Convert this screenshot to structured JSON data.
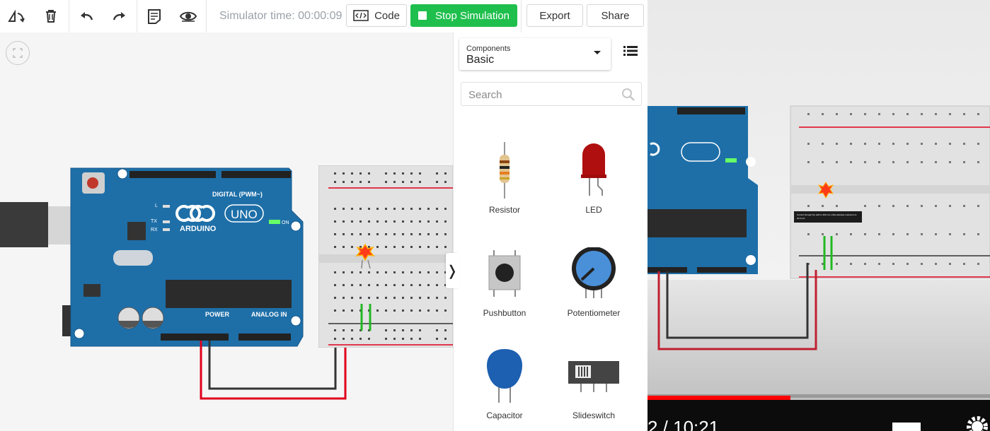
{
  "toolbar": {
    "sim_time": "Simulator time: 00:00:09",
    "code_label": "Code",
    "stop_label": "Stop Simulation",
    "export_label": "Export",
    "share_label": "Share"
  },
  "components": {
    "caption": "Components",
    "selected": "Basic",
    "search_placeholder": "Search",
    "items": [
      {
        "label": "Resistor",
        "icon": "resistor-icon"
      },
      {
        "label": "LED",
        "icon": "led-icon"
      },
      {
        "label": "Pushbutton",
        "icon": "pushbutton-icon"
      },
      {
        "label": "Potentiometer",
        "icon": "potentiometer-icon"
      },
      {
        "label": "Capacitor",
        "icon": "capacitor-icon"
      },
      {
        "label": "Slideswitch",
        "icon": "slideswitch-icon"
      }
    ]
  },
  "board": {
    "brand": "ARDUINO",
    "model": "UNO",
    "digital_label": "DIGITAL (PWM~)",
    "power_label": "POWER",
    "analog_label": "ANALOG IN",
    "on_label": "ON",
    "l_label": "L",
    "tx_label": "TX",
    "rx_label": "RX"
  },
  "video": {
    "time_text": "2 / 10:21",
    "tooltip_text": "Current through the LED is 469 mA, while absolute maximum is 20.0 mA."
  },
  "colors": {
    "accent_green": "#1fbf4d",
    "arduino_blue": "#1e6fa8",
    "wire_red": "#e0001b",
    "progress_red": "#ff0000"
  }
}
